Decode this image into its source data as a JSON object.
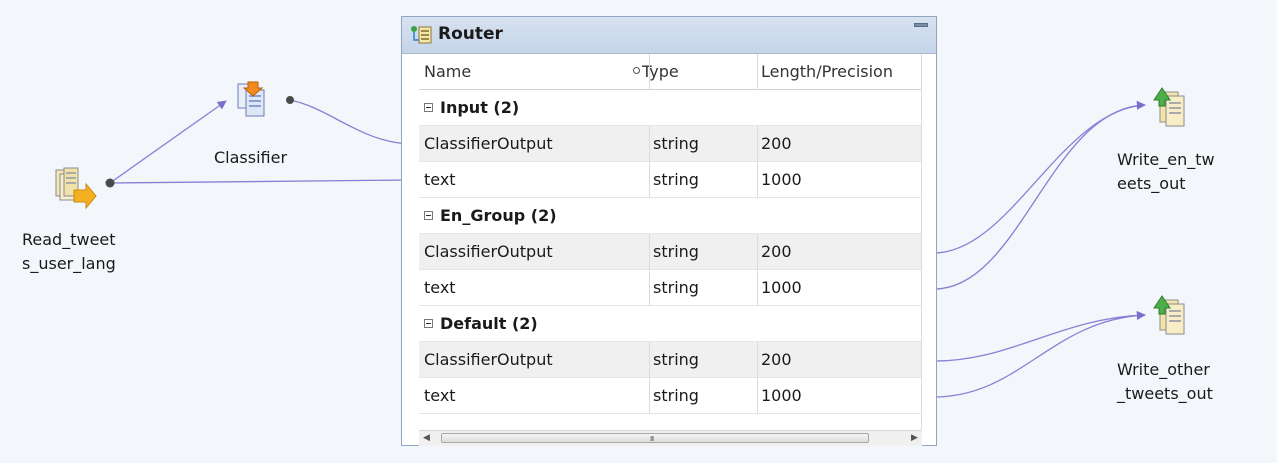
{
  "router": {
    "title": "Router",
    "columns": [
      "Name",
      "Type",
      "Length/Precision"
    ],
    "groups": [
      {
        "label": "Input (2)",
        "ports": [
          {
            "name": "ClassifierOutput",
            "type": "string",
            "length": "200"
          },
          {
            "name": "text",
            "type": "string",
            "length": "1000"
          }
        ]
      },
      {
        "label": "En_Group (2)",
        "ports": [
          {
            "name": "ClassifierOutput",
            "type": "string",
            "length": "200"
          },
          {
            "name": "text",
            "type": "string",
            "length": "1000"
          }
        ]
      },
      {
        "label": "Default (2)",
        "ports": [
          {
            "name": "ClassifierOutput",
            "type": "string",
            "length": "200"
          },
          {
            "name": "text",
            "type": "string",
            "length": "1000"
          }
        ]
      }
    ],
    "scrollbar_grip": "III"
  },
  "nodes": {
    "source": {
      "label": "Read_tweet\ns_user_lang",
      "icon": "source-file-icon"
    },
    "classifier": {
      "label": "Classifier",
      "icon": "classifier-icon"
    },
    "target_en": {
      "label": "Write_en_tw\neets_out",
      "icon": "target-file-icon"
    },
    "target_other": {
      "label": "Write_other\n_tweets_out",
      "icon": "target-file-icon"
    }
  },
  "colors": {
    "link": "#8a7fd6",
    "header_bg": "#c9d7ea",
    "row_alt": "#f0f0f0"
  }
}
